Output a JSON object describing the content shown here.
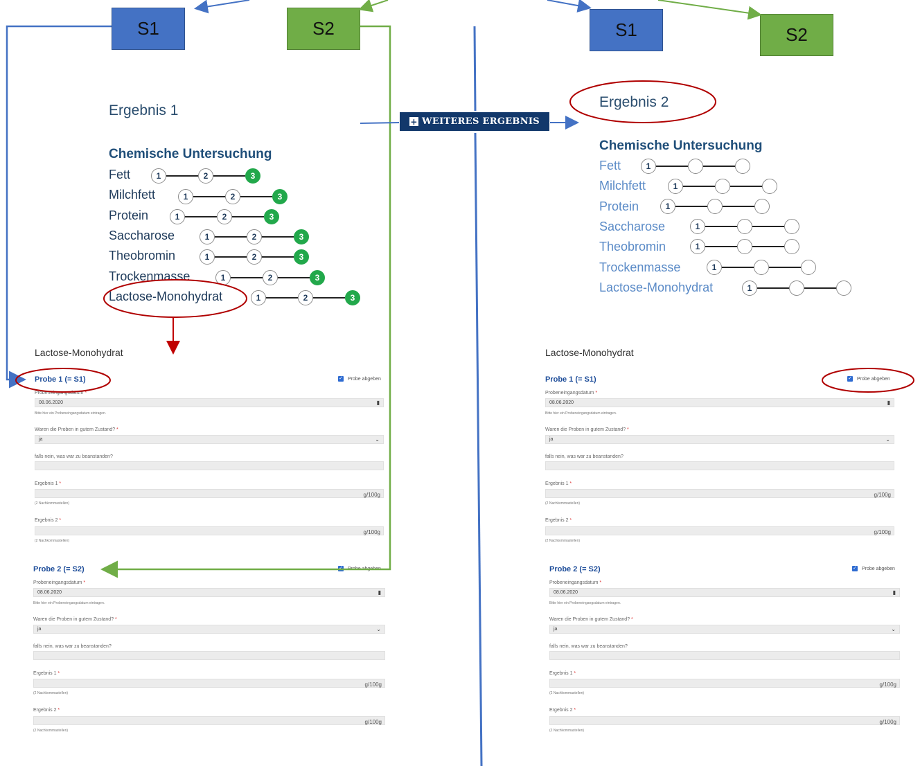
{
  "boxes": {
    "s1": "S1",
    "s2": "S2"
  },
  "left": {
    "result_title": "Ergebnis 1",
    "chem_title": "Chemische Untersuchung",
    "items": [
      "Fett",
      "Milchfett",
      "Protein",
      "Saccharose",
      "Theobromin",
      "Trockenmasse",
      "Lactose-Monohydrat"
    ]
  },
  "right": {
    "result_title": "Ergebnis 2",
    "chem_title": "Chemische Untersuchung",
    "items": [
      "Fett",
      "Milchfett",
      "Protein",
      "Saccharose",
      "Theobromin",
      "Trockenmasse",
      "Lactose-Monohydrat"
    ]
  },
  "steps": [
    "1",
    "2",
    "3"
  ],
  "button": {
    "icon": "plus-icon",
    "label": "WEITERES ERGEBNIS"
  },
  "form": {
    "title": "Lactose-Monohydrat",
    "probe1_title": "Probe 1 (= S1)",
    "probe2_title": "Probe 2 (= S2)",
    "checkbox_label": "Probe abgeben",
    "date_label": "Probeneingangsdatum",
    "date_value": "08.06.2020",
    "date_help": "Bitte hier ein Probeneingangsdatum eintragen.",
    "zustand_label": "Waren die Proben in gutem Zustand?",
    "zustand_value": "ja",
    "beanstandung_label": "falls nein, was war zu beanstanden?",
    "ergebnis1_label": "Ergebnis 1",
    "ergebnis2_label": "Ergebnis 2",
    "unit": "g/100g",
    "decimals_help": "(2 Nachkommastellen)",
    "required_mark": "*"
  }
}
